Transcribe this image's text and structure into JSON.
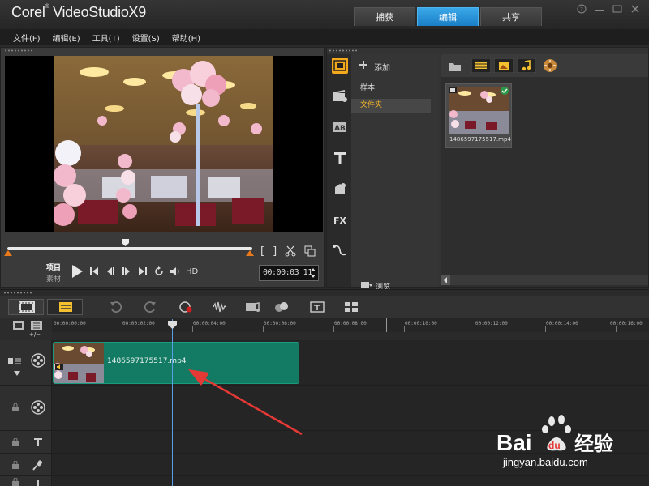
{
  "app": {
    "brand": "Corel",
    "name": "VideoStudio",
    "version": "X9"
  },
  "mode_tabs": [
    {
      "label": "捕获",
      "active": false
    },
    {
      "label": "编辑",
      "active": true
    },
    {
      "label": "共享",
      "active": false
    }
  ],
  "menu": [
    "文件(F)",
    "编辑(E)",
    "工具(T)",
    "设置(S)",
    "帮助(H)"
  ],
  "player": {
    "mode_project": "项目",
    "mode_clip": "素材",
    "hd_label": "HD",
    "timecode": "00:00:03 11",
    "bracket_in": "[",
    "bracket_out": "]",
    "scrub_position": 0.48
  },
  "library": {
    "add_label": "添加",
    "tree": [
      {
        "label": "样本",
        "selected": false
      },
      {
        "label": "文件夹",
        "selected": true
      }
    ],
    "browse_label": "浏览",
    "thumbnails": [
      {
        "name": "1486597175517.mp4",
        "checked": true
      }
    ]
  },
  "timeline": {
    "ruler_ticks": [
      "00:00:00:00",
      "00:00:02:00",
      "00:00:04:00",
      "00:00:06:00",
      "00:00:08:00",
      "00:00:10:00",
      "00:00:12:00",
      "00:00:14:00",
      "00:00:16:00"
    ],
    "zoom_label": "+/−",
    "clip": {
      "name": "1486597175517.mp4"
    }
  },
  "watermark": {
    "brand_a": "Bai",
    "brand_b": "du",
    "brand_cn": "经验",
    "url": "jingyan.baidu.com"
  },
  "colors": {
    "accent_tab": "#1b7fc7",
    "clip": "#137a63",
    "selection_text": "#f4b42a",
    "scrub_handle": "#e97a1c",
    "annotation_arrow": "#e53935"
  }
}
